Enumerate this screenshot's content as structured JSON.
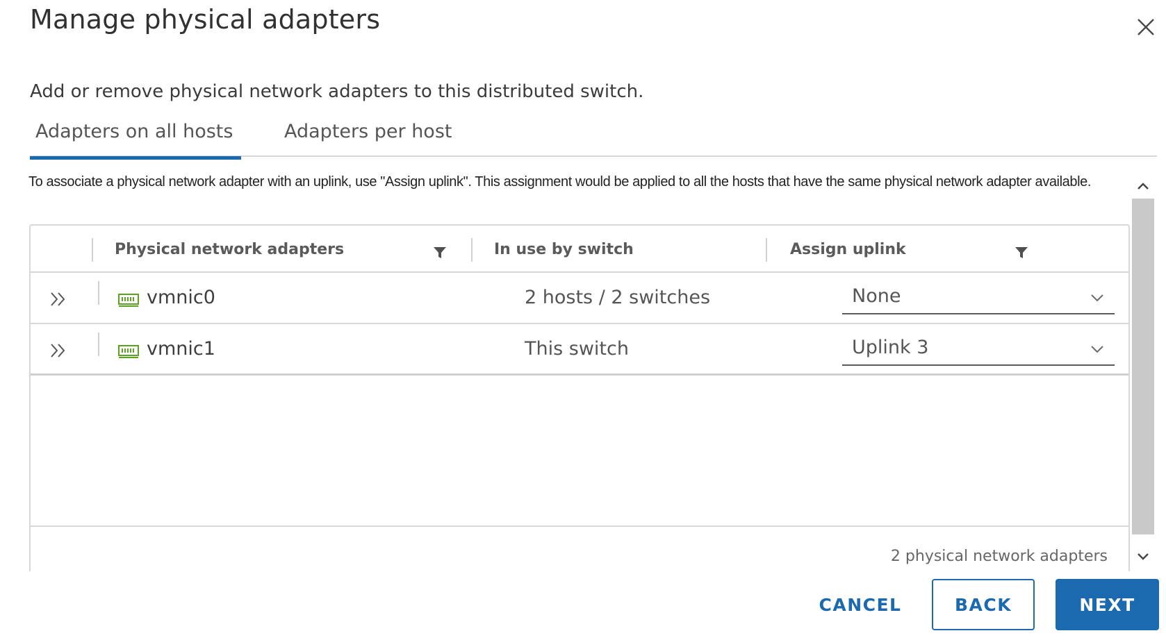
{
  "dialog": {
    "title": "Manage physical adapters",
    "subtitle": "Add or remove physical network adapters to this distributed switch."
  },
  "tabs": [
    {
      "label": "Adapters on all hosts",
      "active": true
    },
    {
      "label": "Adapters per host",
      "active": false
    }
  ],
  "info_text": "To associate a physical network adapter with an uplink, use \"Assign uplink\". This assignment would be applied to all the hosts that have the same physical network adapter available.",
  "grid": {
    "columns": [
      "Physical network adapters",
      "In use by switch",
      "Assign uplink"
    ],
    "rows": [
      {
        "adapter": "vmnic0",
        "in_use": "2 hosts / 2 switches",
        "uplink": "None"
      },
      {
        "adapter": "vmnic1",
        "in_use": "This switch",
        "uplink": "Uplink 3"
      }
    ],
    "footer": "2 physical network adapters"
  },
  "buttons": {
    "cancel": "CANCEL",
    "back": "BACK",
    "next": "NEXT"
  },
  "colors": {
    "accent": "#1b6ab0",
    "nic_icon": "#5aa220",
    "border": "#d7d7d7"
  },
  "icons": [
    "close-icon",
    "filter-icon",
    "expand-double-chevron-icon",
    "network-adapter-icon",
    "chevron-down-icon",
    "scroll-up-icon",
    "scroll-down-icon"
  ]
}
